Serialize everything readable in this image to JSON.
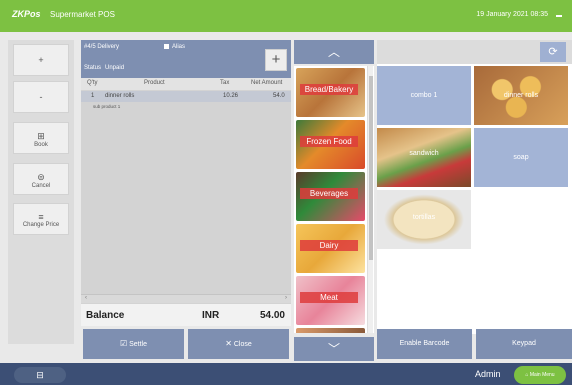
{
  "titlebar": {
    "logo": "ZKPos",
    "title": "Supermarket POS",
    "datetime": "19 January 2021 08:35"
  },
  "sidebar": [
    {
      "name": "plus",
      "glyph": "+",
      "label": ""
    },
    {
      "name": "minus",
      "glyph": "-",
      "label": ""
    },
    {
      "name": "book",
      "glyph": "⊞",
      "label": "Book"
    },
    {
      "name": "cancel",
      "glyph": "⊜",
      "label": "Cancel"
    },
    {
      "name": "change-price",
      "glyph": "≡",
      "label": "Change Price"
    }
  ],
  "order": {
    "type": "#4/5 Delivery",
    "alias_label": "Alias",
    "status_label": "Status",
    "status_value": "Unpaid",
    "add_glyph": "+",
    "columns": {
      "qty": "Q'ty",
      "product": "Product",
      "tax": "Tax",
      "net": "Net Amount"
    },
    "rows": [
      {
        "qty": "1",
        "product": "dinner rolls",
        "tax": "10.26",
        "net": "54.0",
        "sub": "sub product 1"
      }
    ],
    "scroll_left": "‹",
    "scroll_right": "›"
  },
  "balance": {
    "label": "Balance",
    "currency": "INR",
    "amount": "54.00"
  },
  "actions": {
    "settle": "Settle",
    "settle_glyph": "☑",
    "close": "Close",
    "close_glyph": "✕"
  },
  "categories": {
    "up_glyph": "︿",
    "down_glyph": "﹀",
    "items": [
      {
        "label": "Bread/Bakery"
      },
      {
        "label": "Frozen Food"
      },
      {
        "label": "Beverages"
      },
      {
        "label": "Dairy"
      },
      {
        "label": "Meat"
      }
    ]
  },
  "products": {
    "refresh_glyph": "⟳",
    "items": [
      {
        "label": "combo 1"
      },
      {
        "label": "dinner rolls"
      },
      {
        "label": "sandwich"
      },
      {
        "label": "soap"
      },
      {
        "label": "tortillas"
      }
    ]
  },
  "product_buttons": {
    "barcode": "Enable Barcode",
    "keypad": "Keypad"
  },
  "bottombar": {
    "cash_glyph": "⊟",
    "user": "Admin",
    "main_menu": "Main Menu",
    "main_menu_glyph": "⌂"
  },
  "colors": {
    "brand_green": "#7dc142",
    "button_blue": "#7e8fb1",
    "bottom_bar": "#3c4f75",
    "category_label": "#de3c3c"
  }
}
